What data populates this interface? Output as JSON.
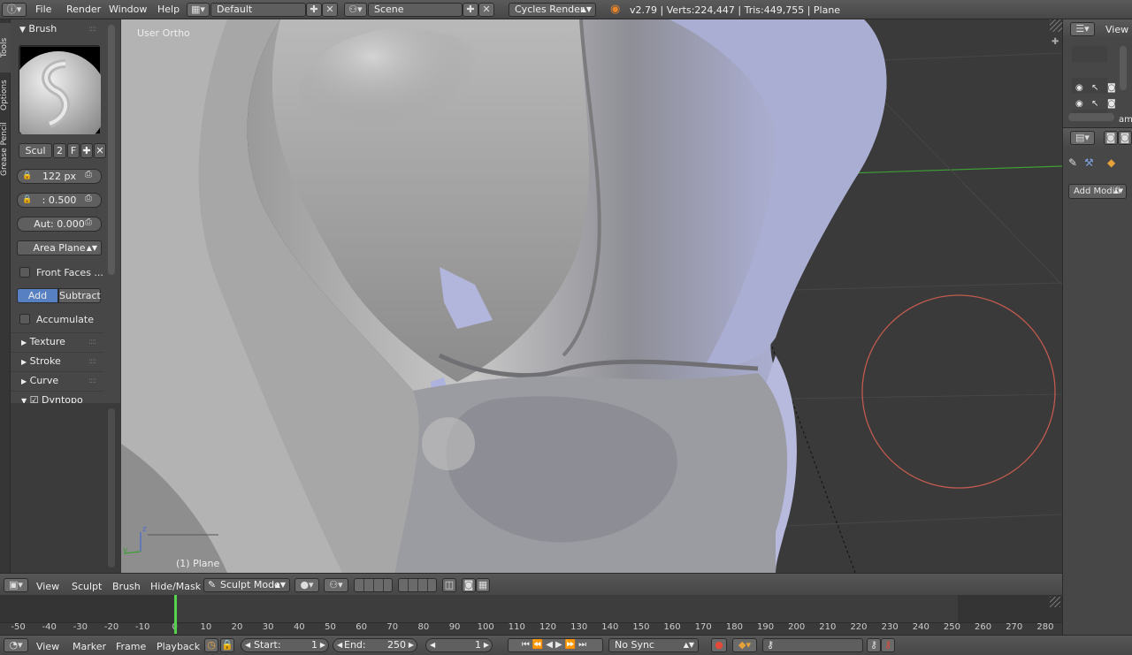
{
  "top_bar": {
    "menus": [
      "File",
      "Render",
      "Window",
      "Help"
    ],
    "screen_layout": "Default",
    "scene": "Scene",
    "render_engine": "Cycles Render",
    "stats": "v2.79 | Verts:224,447 | Tris:449,755 | Plane"
  },
  "tab_strip": [
    "Tools",
    "Options",
    "Grease Pencil"
  ],
  "tool_shelf": {
    "brush_title": "Brush",
    "brush_name": "Scul",
    "brush_users": "2",
    "fake_user": "F",
    "radius": "122 px",
    "strength": ": 0.500",
    "autosmooth": "Aut: 0.000",
    "sculpt_plane": "Area Plane",
    "front_faces": "Front Faces ...",
    "add": "Add",
    "subtract": "Subtract",
    "accumulate": "Accumulate",
    "panels": [
      "Texture",
      "Stroke",
      "Curve",
      "Dyntopo"
    ]
  },
  "viewport": {
    "view_label": "User Ortho",
    "object_label": "(1) Plane",
    "axis_y": "y",
    "axis_z": "z"
  },
  "right_panel": {
    "view_menu": "View",
    "add_modifier": "Add Modifi",
    "truncated": "amp"
  },
  "viewport_header": {
    "menus": [
      "View",
      "Sculpt",
      "Brush",
      "Hide/Mask"
    ],
    "mode": "Sculpt Mode"
  },
  "timeline": {
    "ticks": [
      "-50",
      "-40",
      "-30",
      "-20",
      "-10",
      "0",
      "10",
      "20",
      "30",
      "40",
      "50",
      "60",
      "70",
      "80",
      "90",
      "100",
      "110",
      "120",
      "130",
      "140",
      "150",
      "160",
      "170",
      "180",
      "190",
      "200",
      "210",
      "220",
      "230",
      "240",
      "250",
      "260",
      "270",
      "280"
    ],
    "current_frame_value": 0,
    "menus": [
      "View",
      "Marker",
      "Frame",
      "Playback"
    ],
    "start_label": "Start:",
    "start_value": "1",
    "end_label": "End:",
    "end_value": "250",
    "current_frame": "1",
    "sync": "No Sync"
  },
  "colors": {
    "accent_blue": "#5680c2",
    "brush_circle": "#c05a4e",
    "playhead": "#56d34c",
    "axis_green": "#3f9e35",
    "mesh_lilac": "#b3b6d9"
  }
}
